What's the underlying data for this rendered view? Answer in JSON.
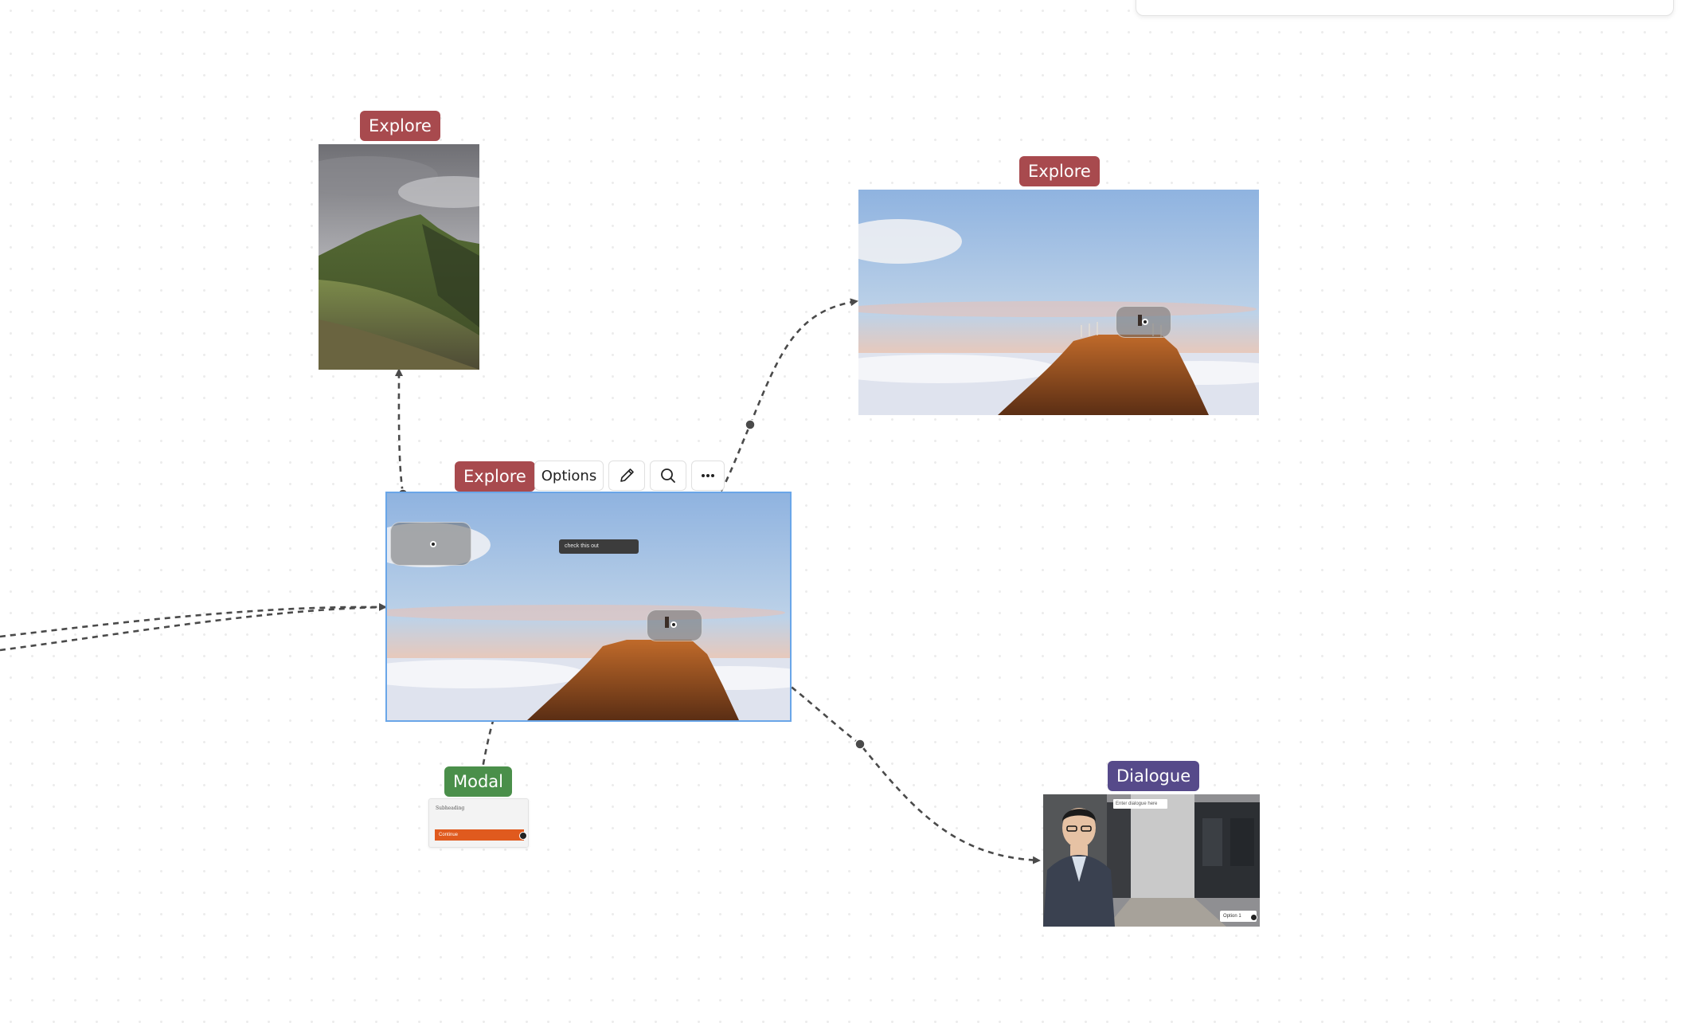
{
  "nodes": {
    "mountain_portrait": {
      "tag": "Explore"
    },
    "summit_view": {
      "tag": "Explore"
    },
    "selected_scene": {
      "tag": "Explore",
      "caption": "check this out"
    },
    "modal": {
      "tag": "Modal",
      "subheading": "Subheading",
      "button_label": "Continue"
    },
    "dialogue": {
      "tag": "Dialogue",
      "input_placeholder": "Enter dialogue here",
      "option_label": "Option 1"
    }
  },
  "toolbar": {
    "options_label": "Options",
    "edit_icon": "pencil-icon",
    "search_icon": "search-icon",
    "more_icon": "more-horizontal-icon"
  },
  "colors": {
    "explore_tag": "#a84a4e",
    "modal_tag": "#4a8f4a",
    "dialogue_tag": "#564a8a",
    "selection_outline": "#6aa6e8",
    "modal_button": "#e05a1e",
    "connector": "#4a4a4a"
  }
}
